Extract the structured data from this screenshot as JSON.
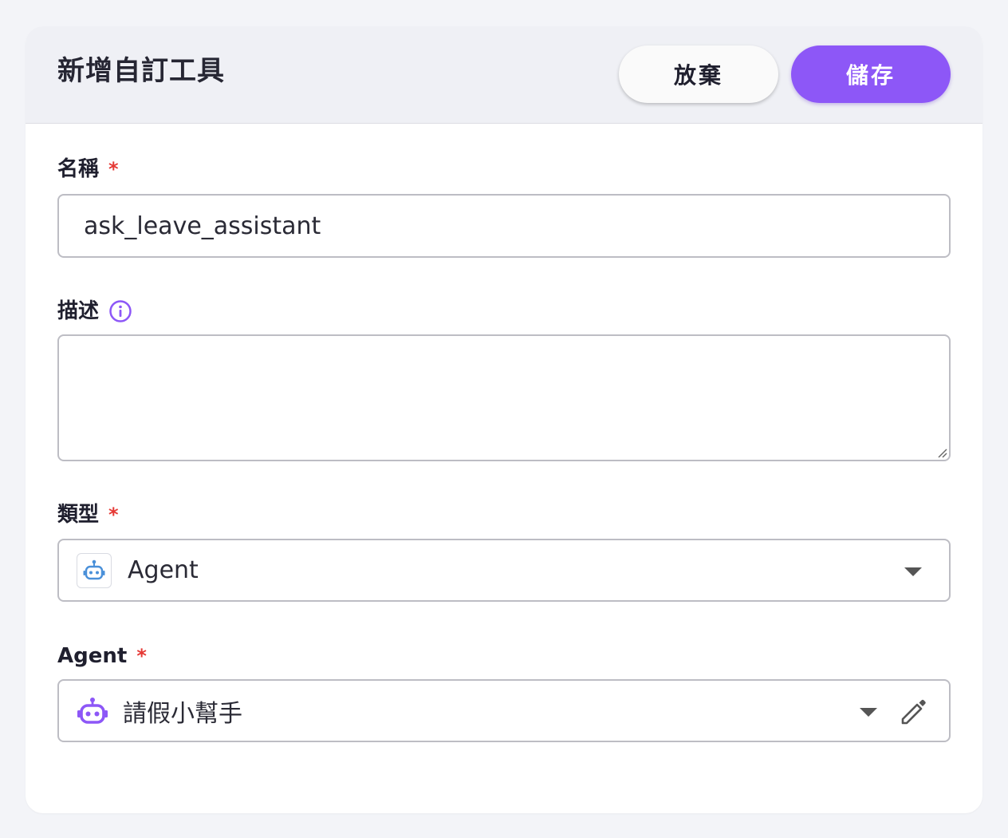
{
  "header": {
    "title": "新增自訂工具",
    "discard_label": "放棄",
    "save_label": "儲存"
  },
  "fields": {
    "name": {
      "label": "名稱",
      "required_mark": "*",
      "value": "ask_leave_assistant"
    },
    "description": {
      "label": "描述",
      "value": "",
      "icon": "info-icon"
    },
    "type": {
      "label": "類型",
      "required_mark": "*",
      "selected": "Agent",
      "icon": "robot-icon"
    },
    "agent": {
      "label": "Agent",
      "required_mark": "*",
      "selected": "請假小幫手",
      "icon": "robot-icon",
      "edit_icon": "pencil-icon"
    }
  },
  "colors": {
    "accent": "#8d57f7",
    "required": "#e53935",
    "type_icon": "#4a90d9",
    "agent_icon": "#8d57f7"
  }
}
